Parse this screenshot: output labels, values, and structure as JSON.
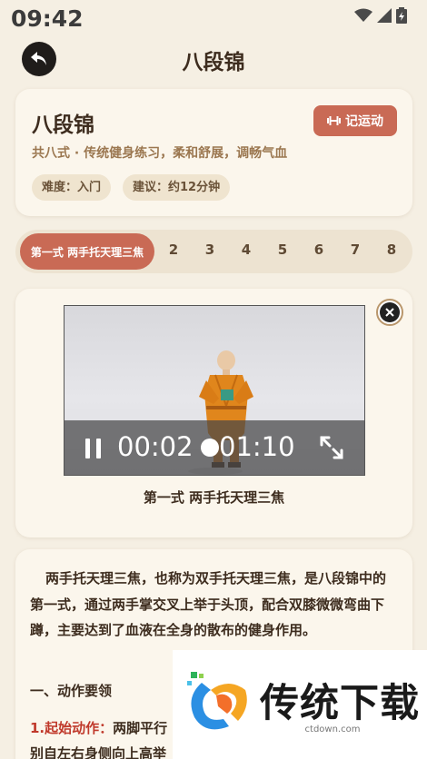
{
  "status_bar": {
    "time": "09:42"
  },
  "header": {
    "title": "八段锦"
  },
  "info_card": {
    "title": "八段锦",
    "log_button": "记运动",
    "subtitle": "共八式 · 传统健身练习，柔和舒展，调畅气血",
    "chips": [
      "难度：入门",
      "建议：约12分钟"
    ]
  },
  "steps": {
    "active_label": "第一式 两手托天理三焦",
    "numbers": [
      "2",
      "3",
      "4",
      "5",
      "6",
      "7",
      "8"
    ]
  },
  "video": {
    "current_time": "00:02",
    "total_time": "01:10",
    "caption": "第一式 两手托天理三焦"
  },
  "content": {
    "intro": "两手托天理三焦，也称为双手托天理三焦，是八段锦中的第一式，通过两手掌交叉上举于头顶，配合双膝微微弯曲下蹲，主要达到了血液在全身的散布的健身作用。",
    "section_heading": "一、动作要领",
    "step1_label": "1.起始动作：",
    "step1_text": "两脚平行",
    "step1_line2": "别自左右身侧向上高举"
  },
  "watermark": {
    "brand": "传统下载",
    "url": "ctdown.com"
  },
  "colors": {
    "accent": "#c96a55",
    "background": "#f5efe3",
    "card": "#fbf6ec"
  }
}
